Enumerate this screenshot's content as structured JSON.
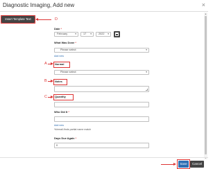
{
  "dialog": {
    "title": "Diagnostic Imaging, Add new",
    "close_glyph": "×"
  },
  "toolbar": {
    "insert_template_label": "Insert Template Text"
  },
  "annotations": {
    "d": "D",
    "a": "A",
    "b": "B",
    "c": "C"
  },
  "form": {
    "date": {
      "label": "Date",
      "required": "*",
      "month": "February",
      "day": "17",
      "year": "2022"
    },
    "what_was_done": {
      "label": "What Was Done",
      "required": "*",
      "placeholder": "Please select",
      "add_new": "Add new"
    },
    "normal": {
      "label": "Normal",
      "placeholder": "Please select"
    },
    "notes": {
      "label": "Notes"
    },
    "quantity": {
      "label": "Quantity"
    },
    "who_did_it": {
      "label": "Who Did It",
      "required": "*",
      "add_new": "Add new",
      "hint": "%/email-finds partial name match"
    },
    "days_due_again": {
      "label": "Days Due Again",
      "required": "*",
      "value": "0"
    }
  },
  "footer": {
    "save_label": "Save",
    "cancel_label": "Cancel"
  },
  "colors": {
    "annotation": "#dd3333",
    "save": "#2f6fb3",
    "dark_button": "#444444"
  }
}
